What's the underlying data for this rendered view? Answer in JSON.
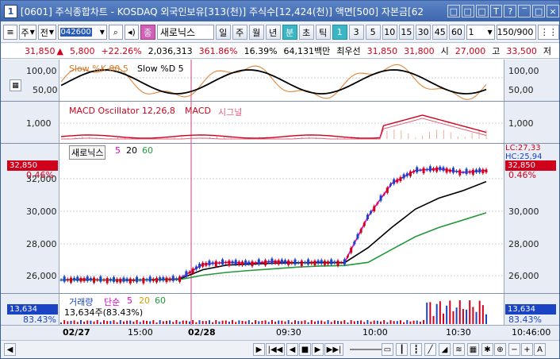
{
  "window": {
    "icon_label": "1",
    "title": "[0601] 주식종합차트 - KOSDAQ 외국인보유[313(천)] 주식수[12,424(천)] 액면[500] 자본금[62",
    "buttons": [
      "□",
      "□",
      "□",
      "T",
      "?",
      "‾",
      "□",
      "×"
    ]
  },
  "toolbar": {
    "list_btn": "≡",
    "market": "주",
    "scope": "전",
    "code": "042600",
    "stock_name": "새로닉스",
    "periods": [
      "일",
      "주",
      "월",
      "년",
      "분",
      "초",
      "틱"
    ],
    "minutes": [
      "1",
      "3",
      "5",
      "10",
      "15",
      "30",
      "45",
      "60"
    ],
    "active_period": "분",
    "active_minute": "1",
    "unit": "1",
    "count": "150/900"
  },
  "info": {
    "price": "31,850",
    "change": "5,800",
    "change_pct": "+22.26%",
    "volume": "2,036,313",
    "vol_ratio": "361.86%",
    "turnover": "16.39%",
    "amount": "64,131백만",
    "best_label": "최우선",
    "ask": "31,850",
    "bid": "31,800",
    "open_label": "시",
    "open": "27,000",
    "high_label": "고",
    "high": "33,500",
    "low_label": "저"
  },
  "panels": {
    "stoch": {
      "legend1": "Slow %K 80,5",
      "legend2": "Slow %D 5",
      "y_ticks": [
        "100,00",
        "50,00"
      ]
    },
    "macd": {
      "legend1": "MACD Oscillator 12,26,8",
      "legend2": "MACD",
      "legend3": "시그널",
      "y_ticks": [
        "1,000"
      ]
    },
    "price": {
      "legend_name": "새로닉스",
      "ma": [
        "5",
        "20",
        "60"
      ],
      "y_ticks": [
        "32,000",
        "30,000",
        "28,000",
        "26,000"
      ],
      "tag_price": "32,850",
      "tag_pct": "0.46%",
      "lc_label": "LC:27,33",
      "hc_label": "HC:25,94"
    },
    "volume": {
      "legend_name": "거래량",
      "legend_type": "단순",
      "ma": [
        "5",
        "20",
        "60"
      ],
      "info": "13,634주(83.43%)",
      "tag_vol": "13,634",
      "tag_pct": "83.43%"
    }
  },
  "xaxis": {
    "labels": [
      "02/27",
      "15:00",
      "02/28",
      "09:30",
      "10:00",
      "10:30"
    ],
    "time": "10:46:00"
  },
  "bottom": {
    "nav": [
      "◀",
      "▶",
      "|◀◀",
      "◀",
      "■",
      "▶",
      "▶▶|"
    ],
    "tools": [
      "−",
      "+",
      "A"
    ]
  },
  "colors": {
    "up": "#d0021b",
    "down": "#1a44c4",
    "ma5": "#e000c8",
    "ma20": "#000000",
    "ma60": "#22993a",
    "tag": "#d0021b"
  },
  "chart_data": {
    "type": "line",
    "price_series": [
      {
        "name": "MA5",
        "values": [
          26050,
          26080,
          26040,
          26020,
          26060,
          26100,
          26900,
          27000,
          26950,
          27050,
          26980,
          27000,
          26990,
          29500,
          31300,
          32000,
          32100,
          31900,
          32000
        ]
      },
      {
        "name": "MA20",
        "values": [
          26050,
          26050,
          26040,
          26040,
          26060,
          26080,
          26600,
          26850,
          26900,
          26950,
          26980,
          26990,
          26980,
          27800,
          28900,
          29900,
          30500,
          30900,
          31400
        ]
      },
      {
        "name": "MA60",
        "values": [
          26050,
          26050,
          26050,
          26050,
          26060,
          26060,
          26300,
          26450,
          26560,
          26650,
          26740,
          26800,
          26830,
          27000,
          27700,
          28400,
          28900,
          29300,
          29700
        ]
      }
    ],
    "ylim": [
      25500,
      33200
    ]
  }
}
